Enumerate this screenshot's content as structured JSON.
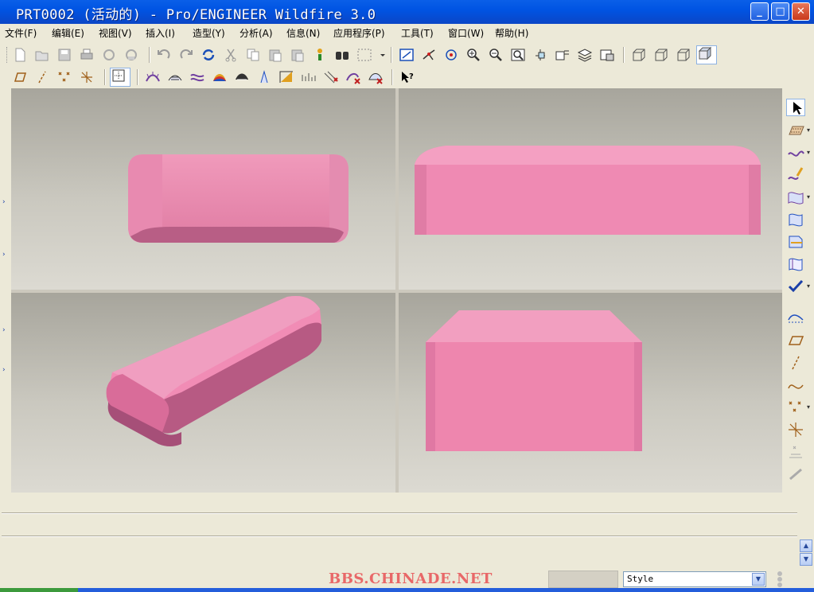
{
  "window": {
    "title": "PRT0002 (活动的) - Pro/ENGINEER Wildfire 3.0",
    "buttons": {
      "minimize": "_",
      "maximize": "□",
      "close": "✕"
    }
  },
  "menu": [
    "文件(F)",
    "编辑(E)",
    "视图(V)",
    "插入(I)",
    "造型(Y)",
    "分析(A)",
    "信息(N)",
    "应用程序(P)",
    "工具(T)",
    "窗口(W)",
    "帮助(H)"
  ],
  "toolbar1": [
    "new-icon",
    "open-icon",
    "save-icon",
    "print-icon",
    "send-mail-icon",
    "send-mail-alt-icon",
    "undo-icon",
    "redo-icon",
    "regenerate-icon",
    "cut-icon",
    "copy-icon",
    "paste-icon",
    "paste-special-icon",
    "model-tree-icon",
    "find-icon",
    "select-box-icon",
    "repaint-icon",
    "spin-center-icon",
    "orient-icon",
    "zoom-in-icon",
    "zoom-out-icon",
    "refit-icon",
    "reorient-icon",
    "saved-views-icon",
    "layers-icon",
    "view-manager-icon",
    "wireframe-icon",
    "hidden-line-icon",
    "no-hidden-icon",
    "shading-icon"
  ],
  "toolbar2": [
    "datum-planes-icon",
    "datum-axes-icon",
    "datum-points-icon",
    "datum-csys-icon",
    "grid-icon",
    "curvature-analysis-icon",
    "section-analysis-icon",
    "offset-analysis-icon",
    "reflection-analysis-icon",
    "dihedral-analysis-icon",
    "slope-analysis-icon",
    "curve-analysis-icon",
    "connection-analysis-icon",
    "delete-analysis-icon",
    "hide-analysis-icon",
    "whats-this-icon"
  ],
  "rightbar": [
    "select-arrow-icon",
    "plane-icon",
    "curve-icon",
    "curve-edit-icon",
    "surface-icon",
    "surface-edit-icon",
    "trim-icon",
    "surface-connect-icon",
    "done-checkmark-icon",
    "curve-on-surface-icon",
    "datum-plane-icon",
    "datum-axis-icon",
    "sketch-curve-icon",
    "datum-point-icon",
    "coordinate-system-icon",
    "analysis-point-icon",
    "link-icon"
  ],
  "viewports": [
    "top-right-view",
    "front-view",
    "isometric-view",
    "side-view"
  ],
  "status": {
    "watermark": "BBS.CHINADE.NET",
    "style_select": "Style"
  },
  "colors": {
    "part": "#ee86ad",
    "titlebar": "#0054e3",
    "background_top": "#a7a59c",
    "background_bottom": "#dcdad2",
    "watermark": "#e86868"
  }
}
